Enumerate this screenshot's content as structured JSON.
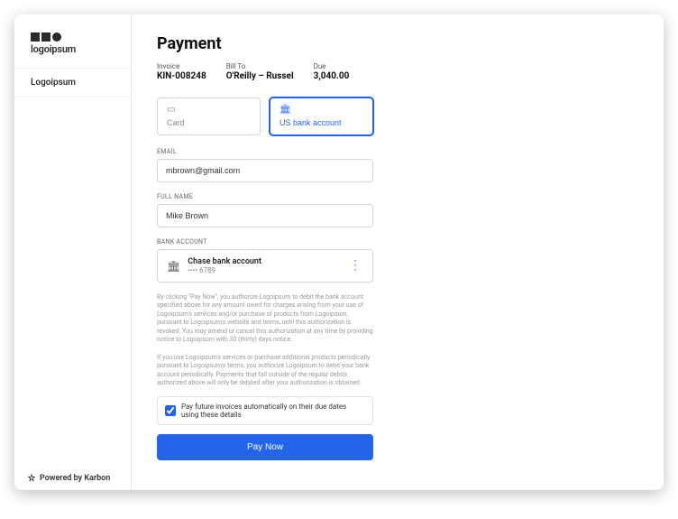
{
  "sidebar": {
    "brand": "logoipsum",
    "org": "Logoipsum",
    "footer": "Powered by Karbon"
  },
  "page": {
    "title": "Payment"
  },
  "meta": {
    "invoice_label": "Invoice",
    "invoice_value": "KIN-008248",
    "billto_label": "Bill To",
    "billto_value": "O'Reilly – Russel",
    "due_label": "Due",
    "due_value": "3,040.00"
  },
  "methods": {
    "card": "Card",
    "bank": "US bank account"
  },
  "form": {
    "email_label": "EMAIL",
    "email_value": "mbrown@gmail.com",
    "fullname_label": "FULL NAME",
    "fullname_value": "Mike Brown",
    "bank_label": "BANK ACCOUNT",
    "bank_name": "Chase bank account",
    "bank_last4": "•••• 6789"
  },
  "legal": {
    "p1": "By clicking \"Pay Now\", you authorize Logoipsum to debit the bank account specified above for any amount owed for charges arising from your use of Logoipsum's services and/or purchase of products from Logoipsum, pursuant to Logoipsum's website and terms, until this authorization is revoked. You may amend or cancel this authorization at any time by providing notice to Logoipsum with 30 (thirty) days notice.",
    "p2": "If you use Logoipsum's services or purchase additional products periodically pursuant to Logoipsum's terms, you authorize Logoipsum to debit your bank account periodically. Payments that fall outside of the regular debits authorized above will only be debited after your authorization is obtained."
  },
  "autopay": {
    "label": "Pay future invoices automatically on their due dates using these details",
    "checked": true
  },
  "actions": {
    "pay": "Pay Now"
  }
}
